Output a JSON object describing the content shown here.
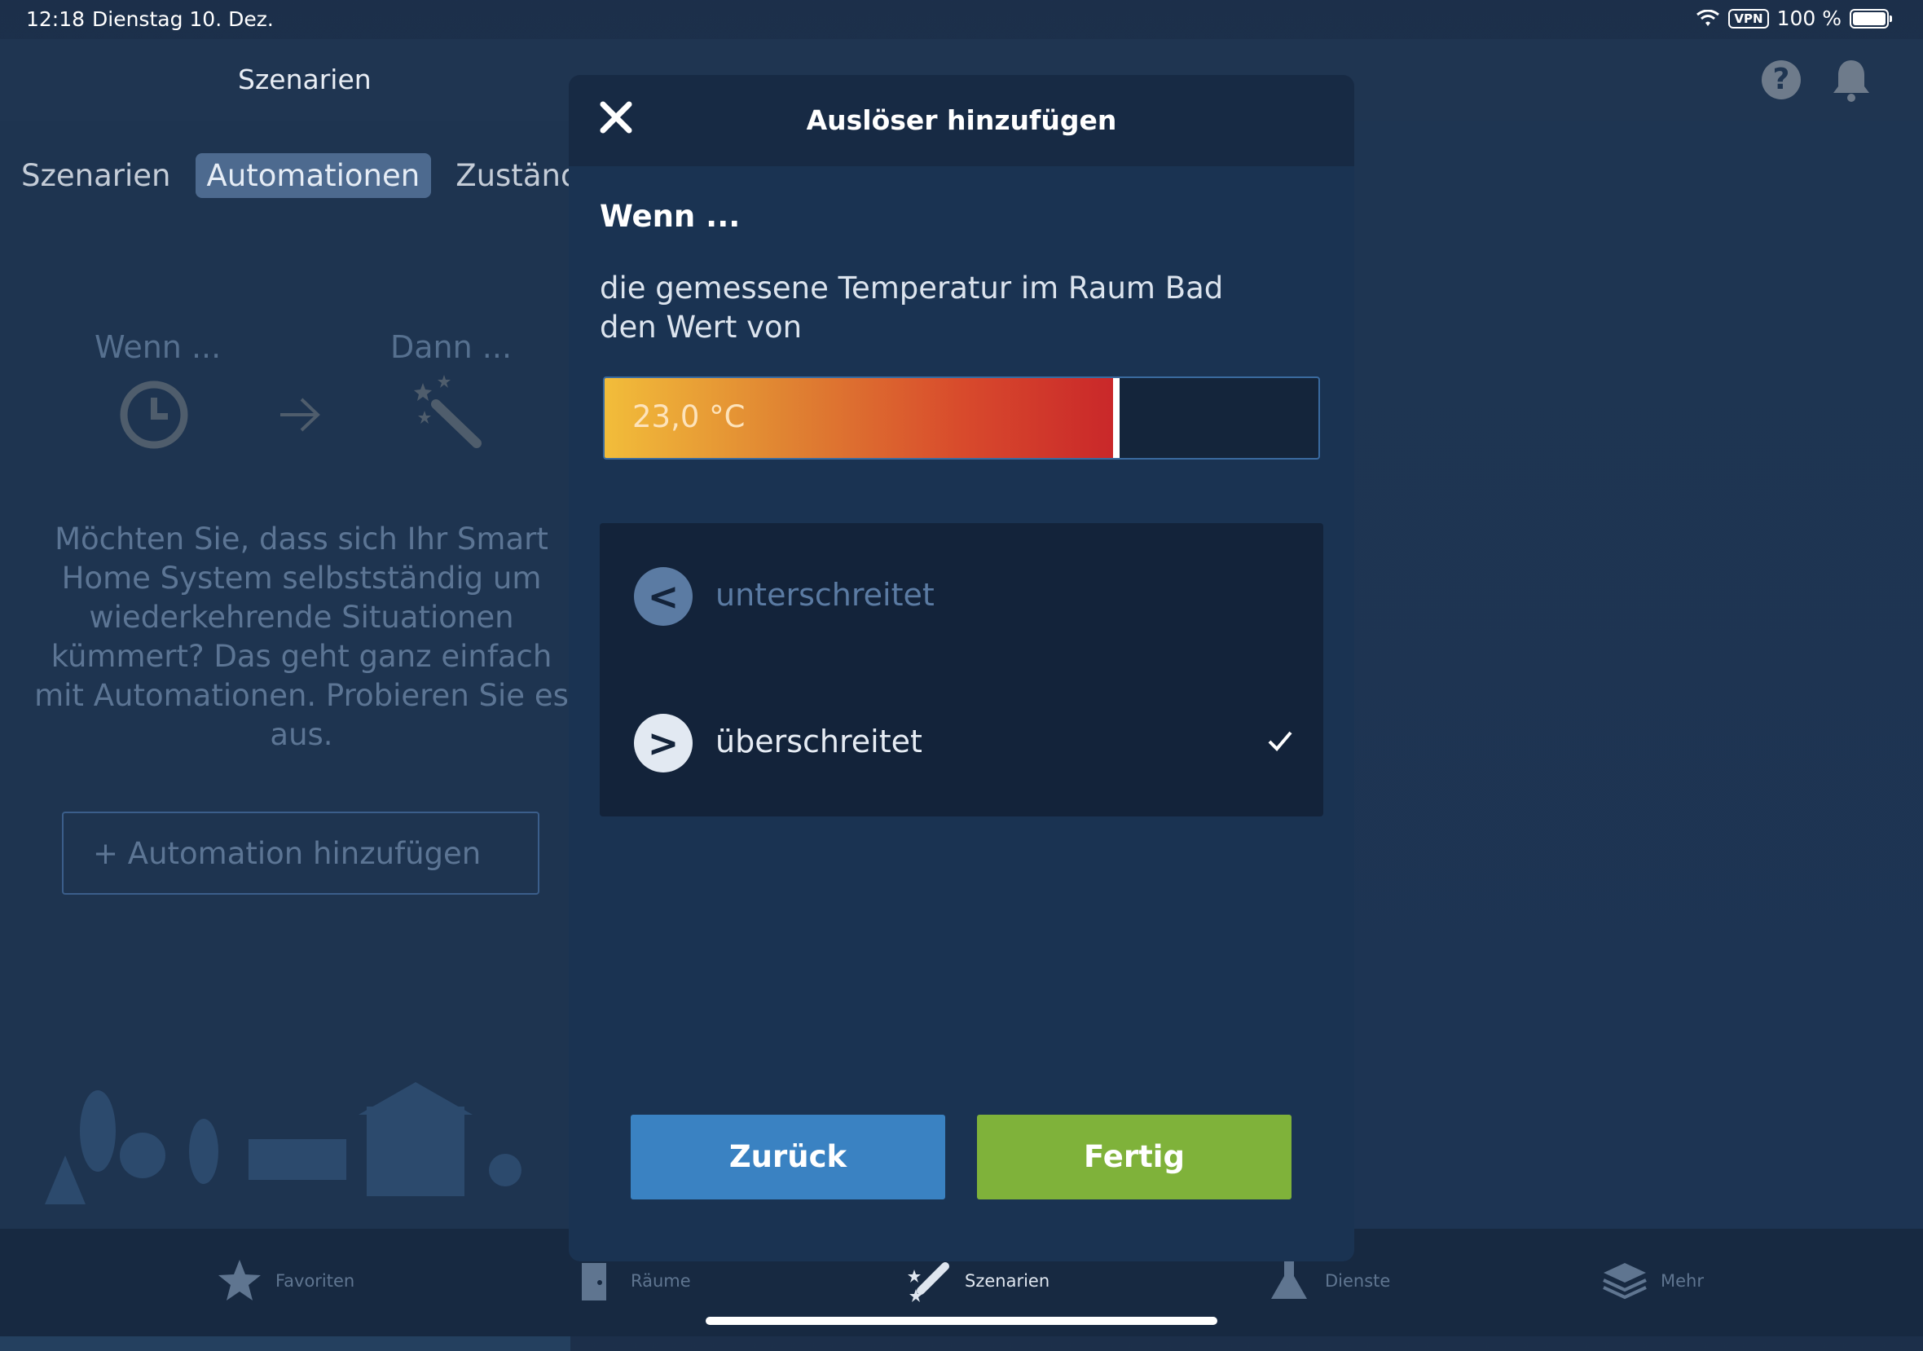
{
  "status": {
    "time": "12:18",
    "date": "Dienstag 10. Dez.",
    "vpn": "VPN",
    "battery": "100 %"
  },
  "header": {
    "title": "Szenarien",
    "help_icon": "question-circle-icon",
    "bell_icon": "bell-icon"
  },
  "tabs": [
    {
      "label": "Szenarien",
      "active": false
    },
    {
      "label": "Automationen",
      "active": true
    },
    {
      "label": "Zustände",
      "active": false
    }
  ],
  "flow": {
    "if_label": "Wenn ...",
    "then_label": "Dann ..."
  },
  "intro_text": "Möchten Sie, dass sich Ihr Smart Home System selbstständig um wiederkehrende Situationen kümmert? Das geht ganz einfach mit Automationen. Probieren Sie es aus.",
  "add_automation": "+ Automation hinzufügen",
  "modal": {
    "title": "Auslöser hinzufügen",
    "when": "Wenn ...",
    "condition": "die gemessene Temperatur im Raum Bad den Wert von",
    "slider": {
      "value_text": "23,0 °C",
      "fill_fraction": 0.717
    },
    "options": [
      {
        "symbol": "<",
        "label": "unterschreitet",
        "selected": false
      },
      {
        "symbol": ">",
        "label": "überschreitet",
        "selected": true
      }
    ],
    "back_button": "Zurück",
    "done_button": "Fertig"
  },
  "tabbar": [
    {
      "label": "Favoriten",
      "icon": "star-icon",
      "active": false
    },
    {
      "label": "Räume",
      "icon": "door-icon",
      "active": false
    },
    {
      "label": "Szenarien",
      "icon": "magic-wand-icon",
      "active": true
    },
    {
      "label": "Dienste",
      "icon": "flask-icon",
      "active": false
    },
    {
      "label": "Mehr",
      "icon": "layers-icon",
      "active": false
    }
  ],
  "colors": {
    "accent_blue": "#3a82c2",
    "accent_green": "#7fb23a",
    "slider_red": "#c9272a",
    "slider_yellow": "#f2bd3a"
  }
}
